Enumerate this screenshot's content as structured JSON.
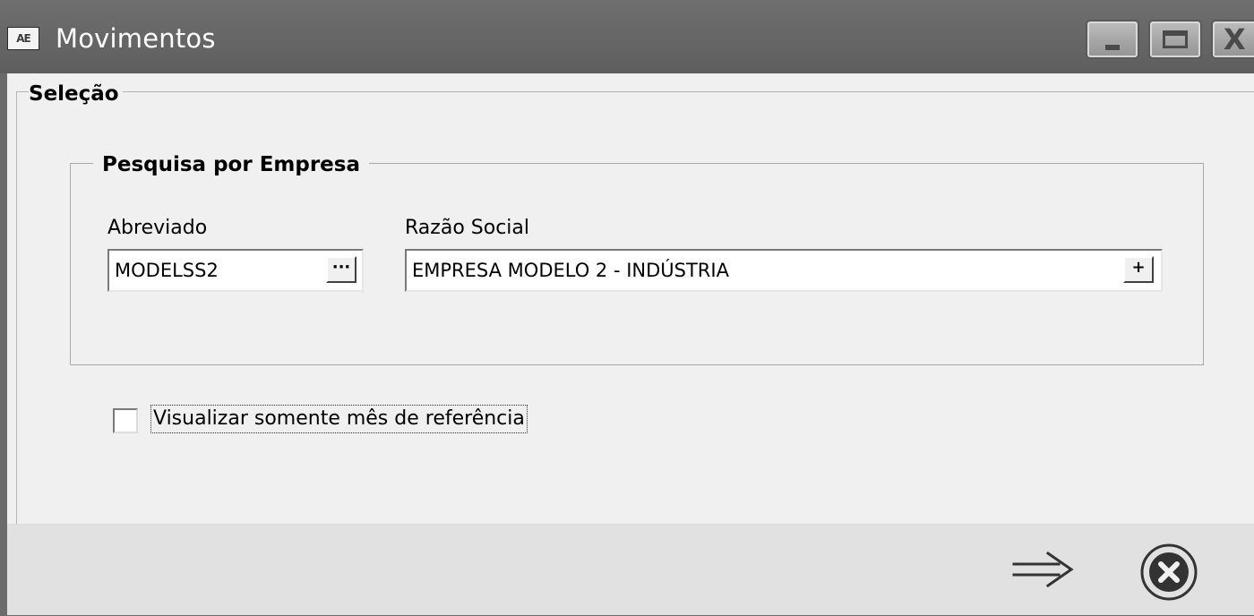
{
  "window": {
    "title": "Movimentos",
    "app_icon_text": "AE"
  },
  "selection": {
    "legend": "Seleção",
    "company_search": {
      "legend": "Pesquisa por Empresa",
      "abbrev_label": "Abreviado",
      "abbrev_value": "MODELSS2",
      "abbrev_button": "···",
      "company_label": "Razão Social",
      "company_value": "EMPRESA MODELO 2 - INDÚSTRIA",
      "company_button": "+"
    },
    "ref_month_checkbox": {
      "label": "Visualizar somente mês de referência",
      "checked": false
    }
  },
  "footer": {
    "next_icon": "right-arrow-icon",
    "cancel_icon": "cancel-circle-icon"
  }
}
